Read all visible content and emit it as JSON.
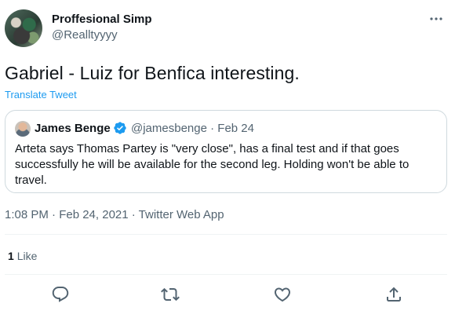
{
  "author": {
    "display_name": "Proffesional Simp",
    "handle": "@Realltyyyy"
  },
  "tweet": {
    "text": "Gabriel - Luiz for Benfica interesting.",
    "translate_label": "Translate Tweet",
    "timestamp": "1:08 PM · Feb 24, 2021 · Twitter Web App"
  },
  "quoted_tweet": {
    "display_name": "James Benge",
    "handle_date": "@jamesbenge · Feb 24",
    "text": "Arteta says Thomas Partey is \"very close\", has a final test and if that goes successfully he will be available for the second leg. Holding won't be able to travel."
  },
  "engagement": {
    "like_count": "1",
    "like_label": "Like"
  },
  "icons": [
    "more-icon",
    "verified-icon",
    "reply-icon",
    "retweet-icon",
    "like-icon",
    "share-icon"
  ],
  "colors": {
    "accent": "#1d9bf0",
    "secondary_text": "#536471",
    "border": "#cfd9de"
  }
}
